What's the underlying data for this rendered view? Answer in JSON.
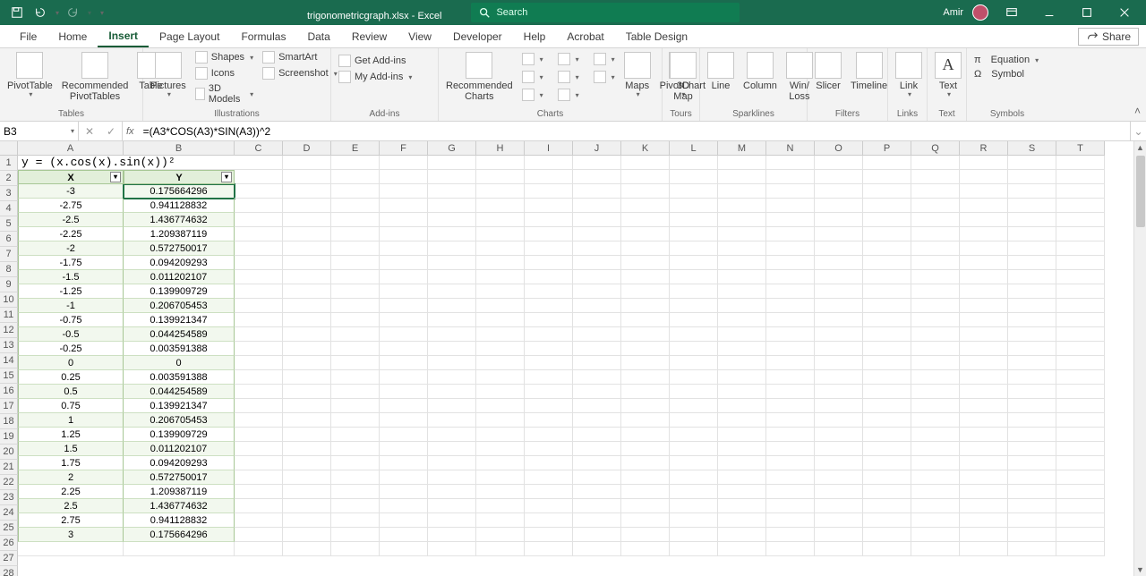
{
  "title": {
    "filename": "trigonometricgraph.xlsx",
    "app": "Excel"
  },
  "search": {
    "placeholder": "Search"
  },
  "user": {
    "name": "Amir"
  },
  "tabs": [
    "File",
    "Home",
    "Insert",
    "Page Layout",
    "Formulas",
    "Data",
    "Review",
    "View",
    "Developer",
    "Help",
    "Acrobat",
    "Table Design"
  ],
  "active_tab": "Insert",
  "share_label": "Share",
  "ribbon": {
    "tables": {
      "pivot": "PivotTable",
      "recommended": "Recommended\nPivotTables",
      "table": "Table",
      "label": "Tables"
    },
    "illustrations": {
      "pictures": "Pictures",
      "shapes": "Shapes",
      "icons": "Icons",
      "models": "3D Models",
      "smartart": "SmartArt",
      "screenshot": "Screenshot",
      "label": "Illustrations"
    },
    "addins": {
      "get": "Get Add-ins",
      "my": "My Add-ins",
      "label": "Add-ins"
    },
    "charts": {
      "recommended": "Recommended\nCharts",
      "maps": "Maps",
      "pivotchart": "PivotChart",
      "label": "Charts"
    },
    "tours": {
      "map3d": "3D\nMap",
      "label": "Tours"
    },
    "sparklines": {
      "line": "Line",
      "column": "Column",
      "winloss": "Win/\nLoss",
      "label": "Sparklines"
    },
    "filters": {
      "slicer": "Slicer",
      "timeline": "Timeline",
      "label": "Filters"
    },
    "links": {
      "link": "Link",
      "label": "Links"
    },
    "text": {
      "text": "Text",
      "label": "Text"
    },
    "symbols": {
      "equation": "Equation",
      "symbol": "Symbol",
      "label": "Symbols"
    }
  },
  "namebox": "B3",
  "formula": "=(A3*COS(A3)*SIN(A3))^2",
  "col_labels": [
    "A",
    "B",
    "C",
    "D",
    "E",
    "F",
    "G",
    "H",
    "I",
    "J",
    "K",
    "L",
    "M",
    "N",
    "O",
    "P",
    "Q",
    "R",
    "S",
    "T"
  ],
  "sheet_title": "y = (x.cos(x).sin(x))²",
  "table_headers": {
    "x": "X",
    "y": "Y"
  },
  "rows": [
    {
      "x": "-3",
      "y": "0.175664296"
    },
    {
      "x": "-2.75",
      "y": "0.941128832"
    },
    {
      "x": "-2.5",
      "y": "1.436774632"
    },
    {
      "x": "-2.25",
      "y": "1.209387119"
    },
    {
      "x": "-2",
      "y": "0.572750017"
    },
    {
      "x": "-1.75",
      "y": "0.094209293"
    },
    {
      "x": "-1.5",
      "y": "0.011202107"
    },
    {
      "x": "-1.25",
      "y": "0.139909729"
    },
    {
      "x": "-1",
      "y": "0.206705453"
    },
    {
      "x": "-0.75",
      "y": "0.139921347"
    },
    {
      "x": "-0.5",
      "y": "0.044254589"
    },
    {
      "x": "-0.25",
      "y": "0.003591388"
    },
    {
      "x": "0",
      "y": "0"
    },
    {
      "x": "0.25",
      "y": "0.003591388"
    },
    {
      "x": "0.5",
      "y": "0.044254589"
    },
    {
      "x": "0.75",
      "y": "0.139921347"
    },
    {
      "x": "1",
      "y": "0.206705453"
    },
    {
      "x": "1.25",
      "y": "0.139909729"
    },
    {
      "x": "1.5",
      "y": "0.011202107"
    },
    {
      "x": "1.75",
      "y": "0.094209293"
    },
    {
      "x": "2",
      "y": "0.572750017"
    },
    {
      "x": "2.25",
      "y": "1.209387119"
    },
    {
      "x": "2.5",
      "y": "1.436774632"
    },
    {
      "x": "2.75",
      "y": "0.941128832"
    },
    {
      "x": "3",
      "y": "0.175664296"
    }
  ]
}
